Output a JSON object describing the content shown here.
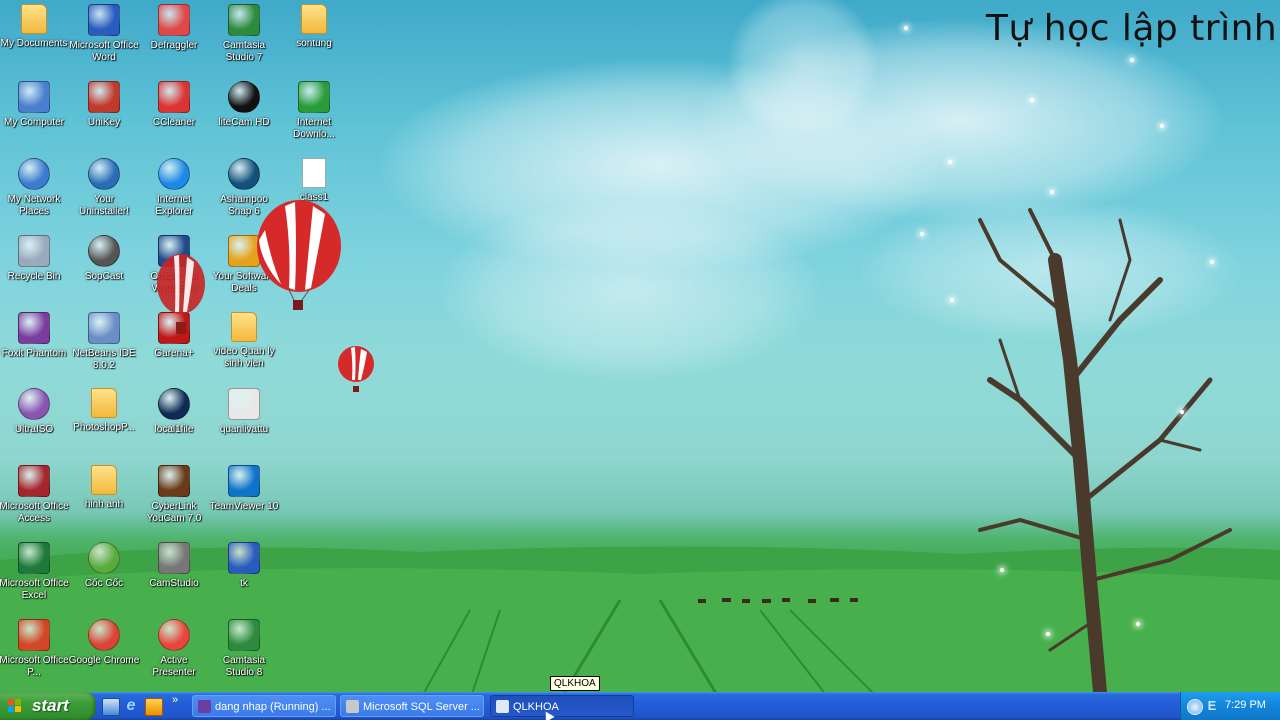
{
  "overlay_title": "Tự học lập trình",
  "desktop_icons": [
    {
      "label": "My Documents",
      "icon": "folder-documents-icon"
    },
    {
      "label": "Microsoft Office Word",
      "icon": "word-icon"
    },
    {
      "label": "Defraggler",
      "icon": "defraggler-icon"
    },
    {
      "label": "Camtasia Studio 7",
      "icon": "camtasia-icon"
    },
    {
      "label": "sontung",
      "icon": "folder-icon"
    },
    {
      "label": "My Computer",
      "icon": "computer-icon"
    },
    {
      "label": "UniKey",
      "icon": "unikey-icon"
    },
    {
      "label": "CCleaner",
      "icon": "ccleaner-icon"
    },
    {
      "label": "liteCam HD",
      "icon": "litecam-icon"
    },
    {
      "label": "Internet Downlo...",
      "icon": "idm-icon"
    },
    {
      "label": "My Network Places",
      "icon": "network-icon"
    },
    {
      "label": "Your Uninstaller!",
      "icon": "uninstaller-icon"
    },
    {
      "label": "Internet Explorer",
      "icon": "ie-icon"
    },
    {
      "label": "Ashampoo Snap 6",
      "icon": "ashampoo-icon"
    },
    {
      "label": "class1",
      "icon": "document-icon"
    },
    {
      "label": "Recycle Bin",
      "icon": "recycle-bin-icon"
    },
    {
      "label": "SopCast",
      "icon": "sopcast-icon"
    },
    {
      "label": "Oracle VM VirtualBox",
      "icon": "virtualbox-icon"
    },
    {
      "label": "Your Software Deals",
      "icon": "cart-icon"
    },
    {
      "label": "Foxit Phantom",
      "icon": "foxit-icon"
    },
    {
      "label": "NetBeans IDE 8.0.2",
      "icon": "netbeans-icon"
    },
    {
      "label": "Garena+",
      "icon": "garena-icon"
    },
    {
      "label": "video Quan ly sinh vien",
      "icon": "folder-icon"
    },
    {
      "label": "UltraISO",
      "icon": "ultraiso-icon"
    },
    {
      "label": "PhotoshopP...",
      "icon": "folder-icon"
    },
    {
      "label": "local1file",
      "icon": "local-file-icon"
    },
    {
      "label": "quanlivattu",
      "icon": "quanlivattu-icon"
    },
    {
      "label": "Microsoft Office Access",
      "icon": "access-icon"
    },
    {
      "label": "hinh anh",
      "icon": "folder-icon"
    },
    {
      "label": "CyberLink YouCam 7.0",
      "icon": "youcam-icon"
    },
    {
      "label": "TeamViewer 10",
      "icon": "teamviewer-icon"
    },
    {
      "label": "Microsoft Office Excel",
      "icon": "excel-icon"
    },
    {
      "label": "Cốc Cốc",
      "icon": "coccoc-icon"
    },
    {
      "label": "CamStudio",
      "icon": "camstudio-icon"
    },
    {
      "label": "tk",
      "icon": "word-doc-icon"
    },
    {
      "label": "Microsoft Office P...",
      "icon": "powerpoint-icon"
    },
    {
      "label": "Google Chrome",
      "icon": "chrome-icon"
    },
    {
      "label": "Active Presenter",
      "icon": "active-presenter-icon"
    },
    {
      "label": "Camtasia Studio 8",
      "icon": "camtasia-icon"
    }
  ],
  "taskbar": {
    "start_label": "start",
    "tasks": [
      {
        "label": "dang nhap (Running) ...",
        "icon": "vs-icon",
        "active": false
      },
      {
        "label": "Microsoft SQL Server ...",
        "icon": "sql-server-icon",
        "active": false
      },
      {
        "label": "QLKHOA",
        "icon": "app-icon",
        "active": true
      }
    ],
    "tooltip": "QLKHOA",
    "clock": "7:29 PM"
  }
}
